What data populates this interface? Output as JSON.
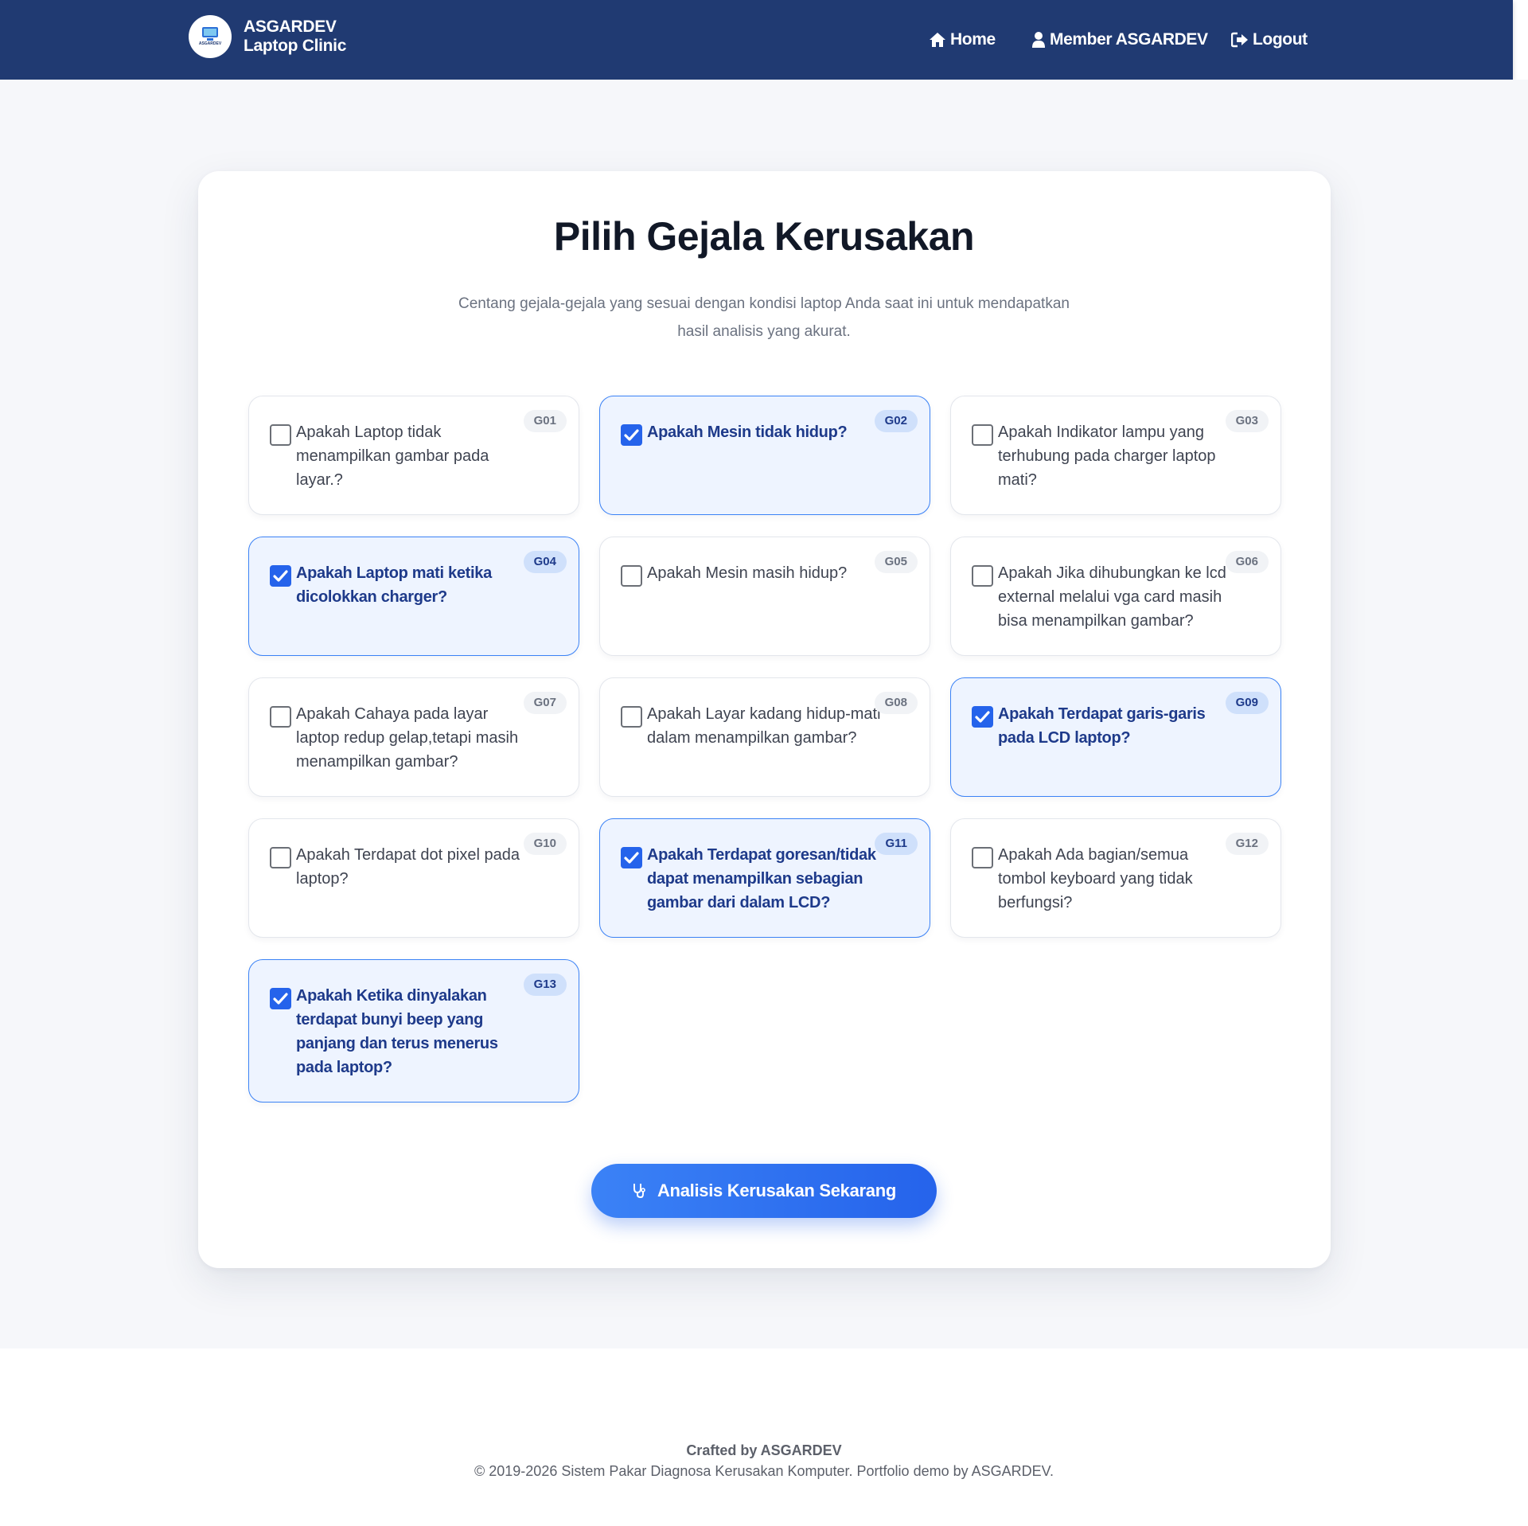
{
  "brand": {
    "name_line1": "ASGARDEV",
    "name_line2": "Laptop Clinic",
    "logo_text": "ASGARDEV"
  },
  "nav": {
    "home": "Home",
    "member": "Member ASGARDEV",
    "logout": "Logout"
  },
  "page": {
    "title": "Pilih Gejala Kerusakan",
    "subtitle": "Centang gejala-gejala yang sesuai dengan kondisi laptop Anda saat ini untuk mendapatkan hasil analisis yang akurat."
  },
  "symptoms": [
    {
      "code": "G01",
      "text": "Apakah Laptop tidak menampilkan gambar pada layar.?",
      "checked": false
    },
    {
      "code": "G02",
      "text": "Apakah Mesin tidak hidup?",
      "checked": true
    },
    {
      "code": "G03",
      "text": "Apakah Indikator lampu yang terhubung pada charger laptop mati?",
      "checked": false
    },
    {
      "code": "G04",
      "text": "Apakah Laptop mati ketika dicolokkan charger?",
      "checked": true
    },
    {
      "code": "G05",
      "text": "Apakah Mesin masih hidup?",
      "checked": false
    },
    {
      "code": "G06",
      "text": "Apakah Jika dihubungkan ke lcd external melalui vga card masih bisa menampilkan gambar?",
      "checked": false
    },
    {
      "code": "G07",
      "text": "Apakah Cahaya pada layar laptop redup gelap,tetapi masih menampilkan gambar?",
      "checked": false
    },
    {
      "code": "G08",
      "text": "Apakah Layar kadang hidup-mati dalam menampilkan gambar?",
      "checked": false
    },
    {
      "code": "G09",
      "text": "Apakah Terdapat garis-garis pada LCD laptop?",
      "checked": true
    },
    {
      "code": "G10",
      "text": "Apakah Terdapat dot pixel pada laptop?",
      "checked": false
    },
    {
      "code": "G11",
      "text": "Apakah Terdapat goresan/tidak dapat menampilkan sebagian gambar dari dalam LCD?",
      "checked": true
    },
    {
      "code": "G12",
      "text": "Apakah Ada bagian/semua tombol keyboard yang tidak berfungsi?",
      "checked": false
    },
    {
      "code": "G13",
      "text": "Apakah Ketika dinyalakan terdapat bunyi beep yang panjang dan terus menerus pada laptop?",
      "checked": true
    }
  ],
  "actions": {
    "analyze_label": "Analisis Kerusakan Sekarang"
  },
  "footer": {
    "crafted": "Crafted by ASGARDEV",
    "copyright": "© 2019-2026 Sistem Pakar Diagnosa Kerusakan Komputer. Portfolio demo by ASGARDEV."
  },
  "colors": {
    "navbar": "#203a72",
    "accent": "#2563eb",
    "checked_bg": "#eef4ff",
    "page_bg": "#f6f7fa"
  },
  "icons": {
    "home": "home-icon",
    "member": "user-icon",
    "logout": "logout-icon",
    "analyze": "stethoscope-icon"
  }
}
